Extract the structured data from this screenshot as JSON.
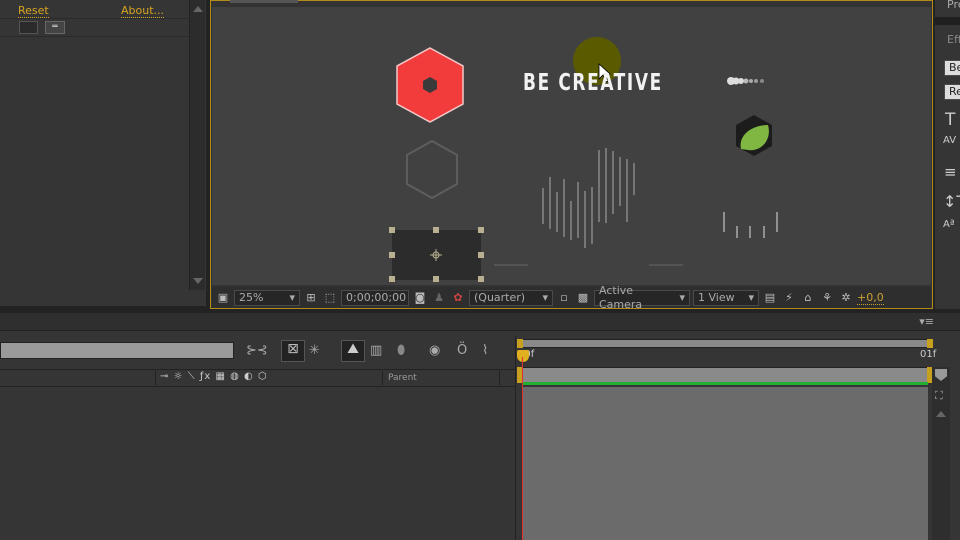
{
  "effect_panel": {
    "reset_label": "Reset",
    "about_label": "About..."
  },
  "viewer": {
    "title_text": "BE CREATIVE",
    "zoom": "25%",
    "timecode": "0;00;00;00",
    "resolution": "(Quarter)",
    "camera": "Active Camera",
    "views": "1 View",
    "exposure": "+0,0",
    "colors": {
      "hexagon": "#f23c3c",
      "leaf": "#7fb742",
      "border": "#b48a18",
      "cursor_highlight": "#5a5a00"
    }
  },
  "right_panel": {
    "tab_top": "Pre",
    "tab_effects": "Eff",
    "field1": "Be",
    "field2": "Re"
  },
  "timeline": {
    "columns": {
      "parent": "Parent"
    },
    "ruler": {
      "start": "00f",
      "end": "01f"
    },
    "colors": {
      "work_bar": "#22b030",
      "playhead": "#e03030"
    }
  }
}
